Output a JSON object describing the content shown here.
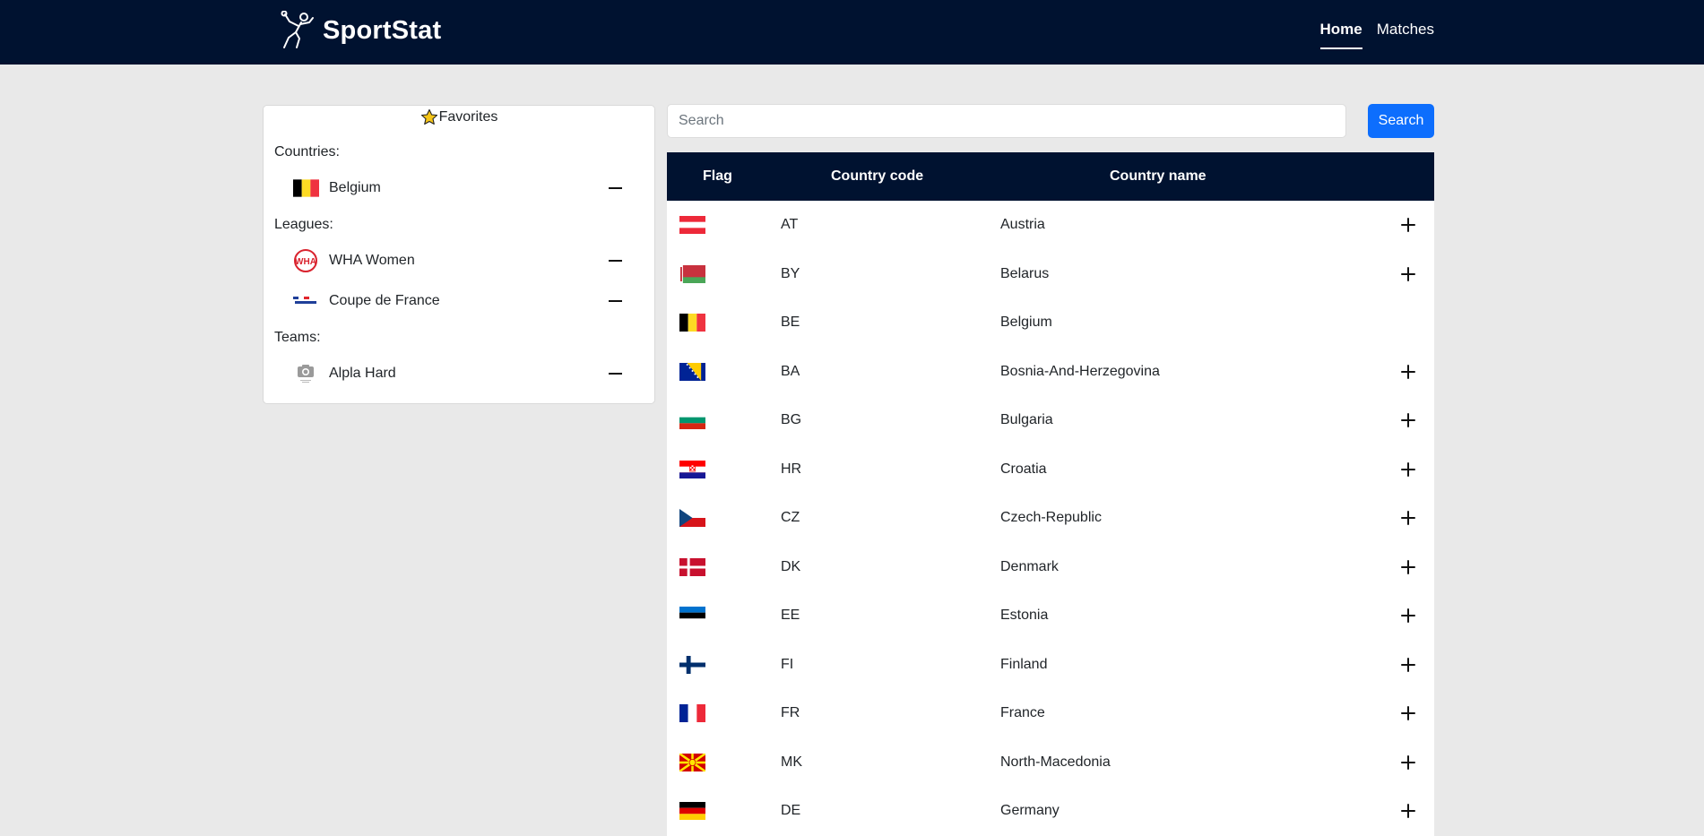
{
  "brand": {
    "name": "SportStat",
    "logo_icon": "handball-player-icon"
  },
  "nav": {
    "items": [
      {
        "label": "Home",
        "active": true
      },
      {
        "label": "Matches",
        "active": false
      }
    ]
  },
  "favorites": {
    "title": "Favorites",
    "star_icon": "star-icon",
    "countries_label": "Countries:",
    "countries": [
      {
        "name": "Belgium",
        "icon": "flag-be"
      }
    ],
    "leagues_label": "Leagues:",
    "leagues": [
      {
        "name": "WHA Women",
        "icon": "wha-logo"
      },
      {
        "name": "Coupe de France",
        "icon": "coupe-de-france-logo"
      }
    ],
    "teams_label": "Teams:",
    "teams": [
      {
        "name": "Alpla Hard",
        "icon": "camera-placeholder-icon"
      }
    ]
  },
  "search": {
    "placeholder": "Search",
    "value": "",
    "button_label": "Search",
    "button_color": "#0d6efd"
  },
  "table": {
    "headers": {
      "flag": "Flag",
      "code": "Country code",
      "name": "Country name"
    },
    "header_color": "#001230",
    "rows": [
      {
        "code": "AT",
        "name": "Austria",
        "flag": "at",
        "favorite": false
      },
      {
        "code": "BY",
        "name": "Belarus",
        "flag": "by",
        "favorite": false
      },
      {
        "code": "BE",
        "name": "Belgium",
        "flag": "be",
        "favorite": true
      },
      {
        "code": "BA",
        "name": "Bosnia-And-Herzegovina",
        "flag": "ba",
        "favorite": false
      },
      {
        "code": "BG",
        "name": "Bulgaria",
        "flag": "bg",
        "favorite": false
      },
      {
        "code": "HR",
        "name": "Croatia",
        "flag": "hr",
        "favorite": false
      },
      {
        "code": "CZ",
        "name": "Czech-Republic",
        "flag": "cz",
        "favorite": false
      },
      {
        "code": "DK",
        "name": "Denmark",
        "flag": "dk",
        "favorite": false
      },
      {
        "code": "EE",
        "name": "Estonia",
        "flag": "ee",
        "favorite": false
      },
      {
        "code": "FI",
        "name": "Finland",
        "flag": "fi",
        "favorite": false
      },
      {
        "code": "FR",
        "name": "France",
        "flag": "fr",
        "favorite": false
      },
      {
        "code": "MK",
        "name": "North-Macedonia",
        "flag": "mk",
        "favorite": false
      },
      {
        "code": "DE",
        "name": "Germany",
        "flag": "de",
        "favorite": false
      }
    ]
  }
}
